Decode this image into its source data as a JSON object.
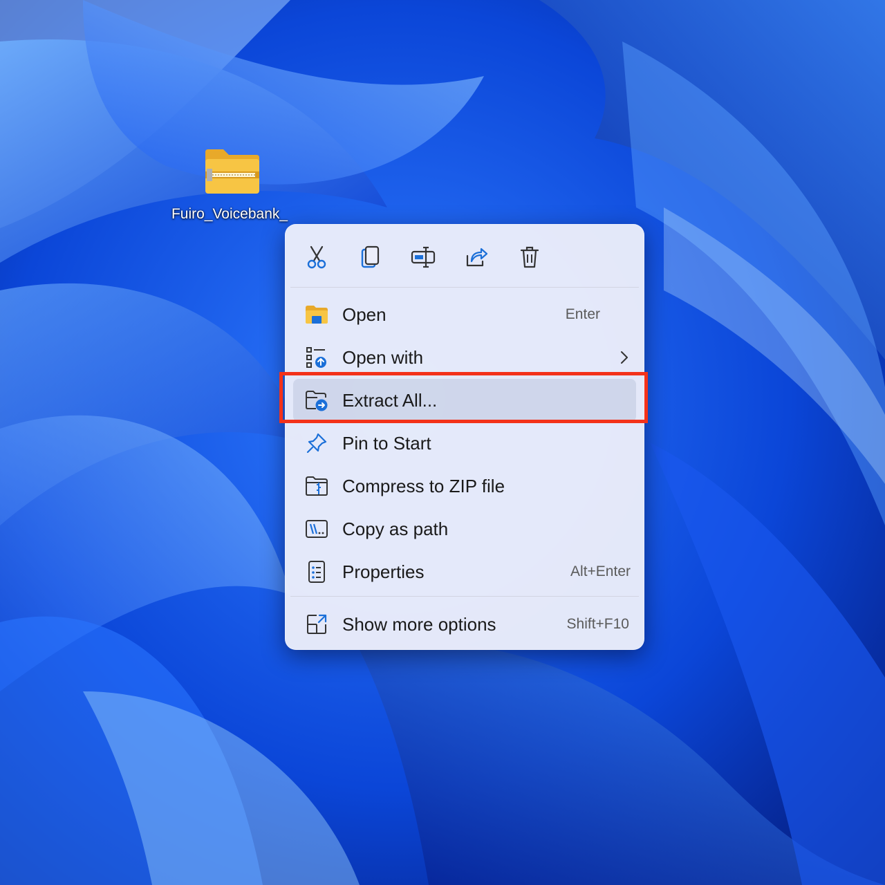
{
  "desktop": {
    "file_label": "Fuiro_Voicebank_",
    "file_icon": "zip-folder-icon"
  },
  "menu": {
    "toolbar": [
      {
        "name": "cut",
        "icon": "scissors-icon"
      },
      {
        "name": "copy",
        "icon": "copy-icon"
      },
      {
        "name": "rename",
        "icon": "rename-icon"
      },
      {
        "name": "share",
        "icon": "share-icon"
      },
      {
        "name": "delete",
        "icon": "trash-icon"
      }
    ],
    "items": [
      {
        "label": "Open",
        "accelerator": "Enter",
        "icon": "folder-icon"
      },
      {
        "label": "Open with",
        "accelerator": "",
        "icon": "open-with-icon",
        "submenu": true
      },
      {
        "label": "Extract All...",
        "accelerator": "",
        "icon": "extract-icon",
        "highlighted": true
      },
      {
        "label": "Pin to Start",
        "accelerator": "",
        "icon": "pin-icon"
      },
      {
        "label": "Compress to ZIP file",
        "accelerator": "",
        "icon": "zip-icon"
      },
      {
        "label": "Copy as path",
        "accelerator": "",
        "icon": "path-icon"
      },
      {
        "label": "Properties",
        "accelerator": "Alt+Enter",
        "icon": "properties-icon"
      }
    ],
    "more": {
      "label": "Show more options",
      "accelerator": "Shift+F10",
      "icon": "show-more-icon"
    }
  },
  "colors": {
    "highlight_border": "#f3321a",
    "icon_accent": "#1b6fd8",
    "folder_yellow": "#f7c544"
  }
}
